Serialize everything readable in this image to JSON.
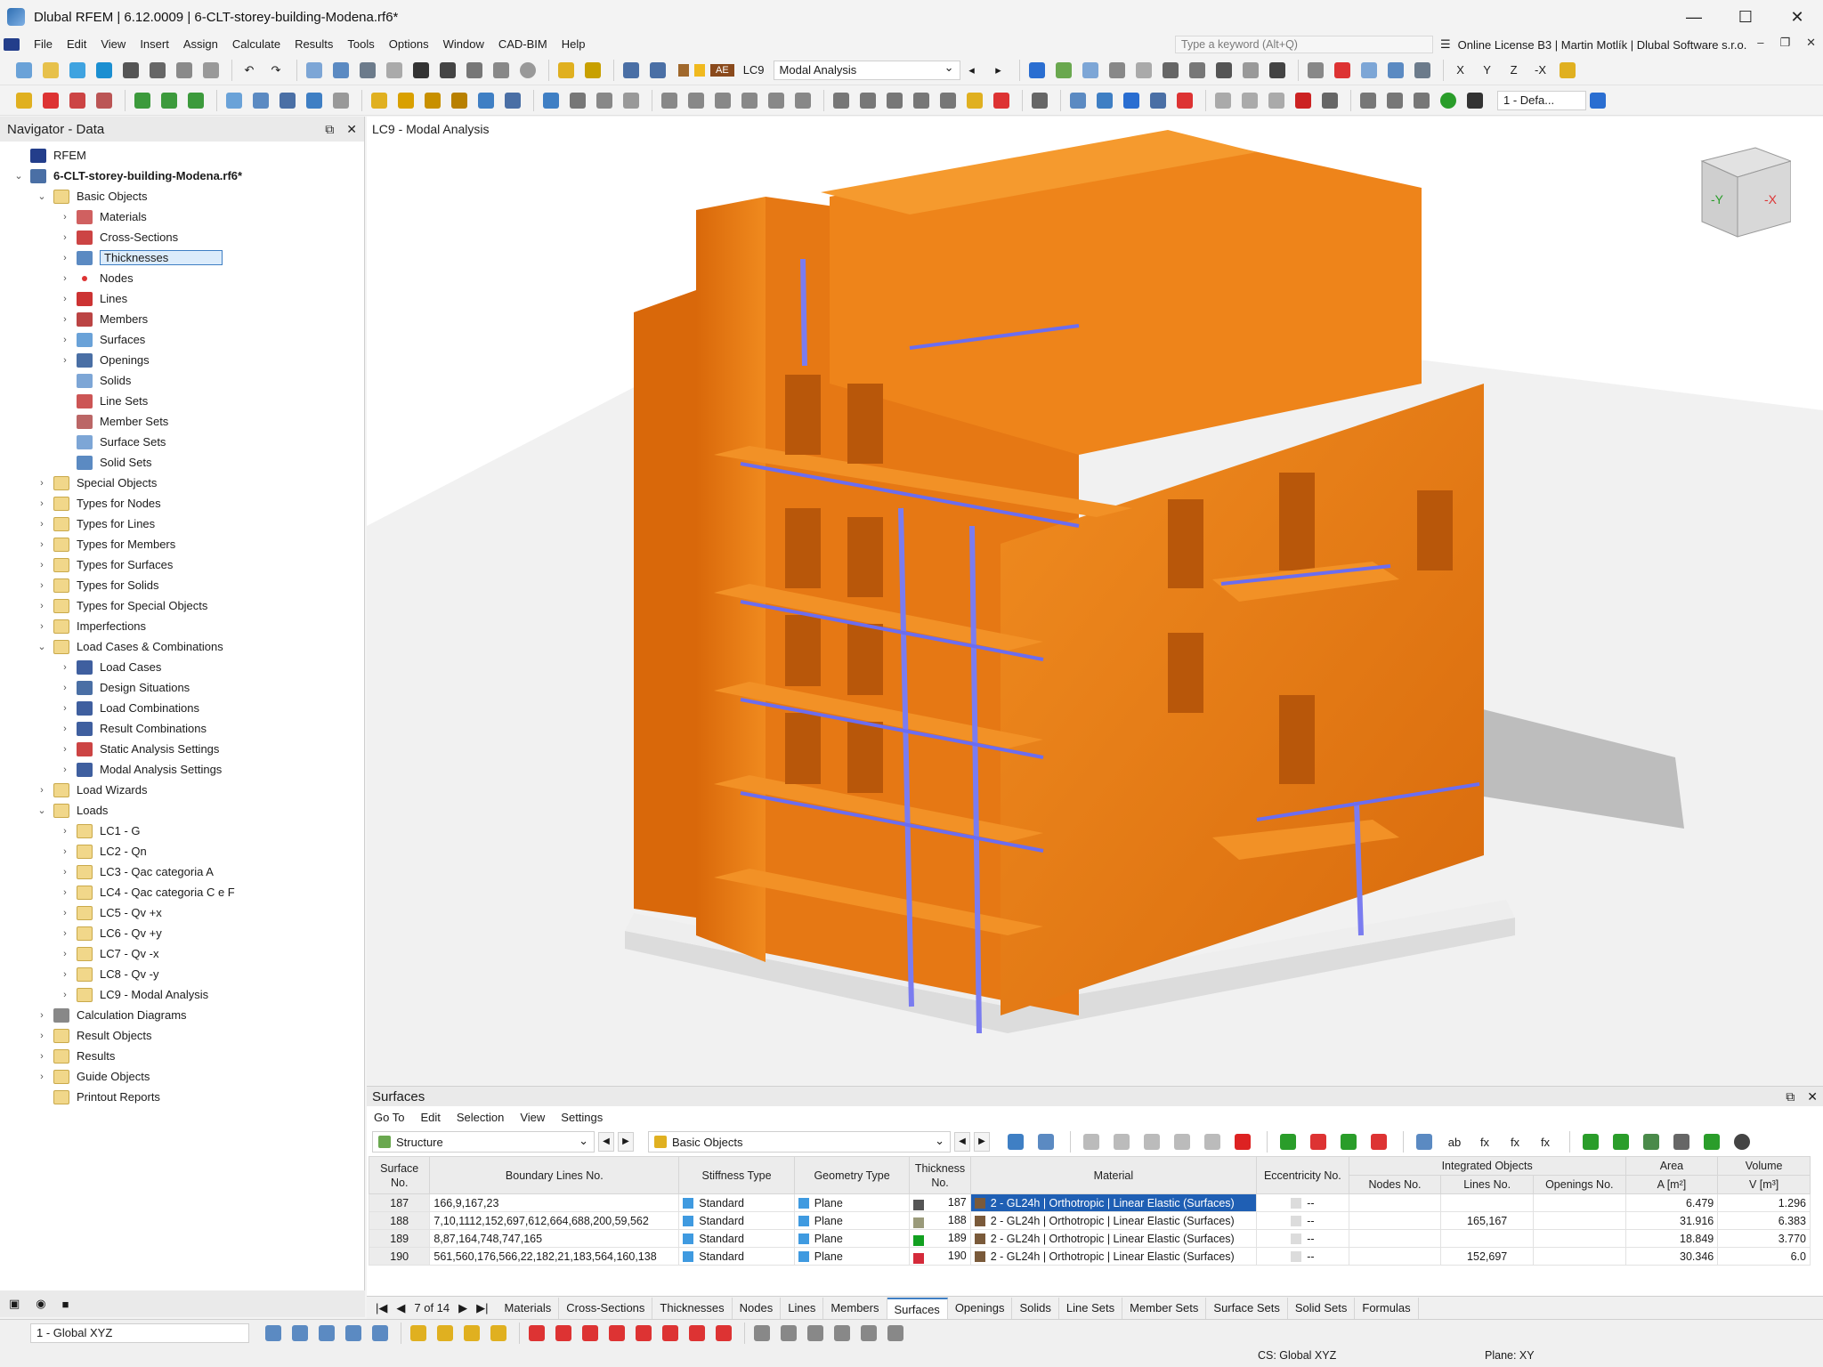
{
  "window": {
    "title": "Dlubal RFEM | 6.12.0009 | 6-CLT-storey-building-Modena.rf6*"
  },
  "menu": [
    "File",
    "Edit",
    "View",
    "Insert",
    "Assign",
    "Calculate",
    "Results",
    "Tools",
    "Options",
    "Window",
    "CAD-BIM",
    "Help"
  ],
  "search": {
    "placeholder": "Type a keyword (Alt+Q)"
  },
  "license": "Online License B3 | Martin Motlík | Dlubal Software s.r.o.",
  "toolbar": {
    "ae": "AE",
    "lc": "LC9",
    "lc_name": "Modal Analysis",
    "view_combo": "1 - Defa..."
  },
  "navigator": {
    "title": "Navigator - Data",
    "items": [
      {
        "label": "RFEM",
        "level": 0,
        "icon": "rfem-logo",
        "arrow": ""
      },
      {
        "label": "6-CLT-storey-building-Modena.rf6*",
        "level": 0,
        "icon": "file",
        "arrow": "v",
        "bold": true
      },
      {
        "label": "Basic Objects",
        "level": 1,
        "icon": "folder",
        "arrow": "v"
      },
      {
        "label": "Materials",
        "level": 2,
        "icon": "materials",
        "arrow": ">"
      },
      {
        "label": "Cross-Sections",
        "level": 2,
        "icon": "cross-sections",
        "arrow": ">"
      },
      {
        "label": "Thicknesses",
        "level": 2,
        "icon": "thicknesses",
        "arrow": ">",
        "selected": true
      },
      {
        "label": "Nodes",
        "level": 2,
        "icon": "nodes",
        "arrow": ">"
      },
      {
        "label": "Lines",
        "level": 2,
        "icon": "lines",
        "arrow": ">"
      },
      {
        "label": "Members",
        "level": 2,
        "icon": "members",
        "arrow": ">"
      },
      {
        "label": "Surfaces",
        "level": 2,
        "icon": "surfaces",
        "arrow": ">"
      },
      {
        "label": "Openings",
        "level": 2,
        "icon": "openings",
        "arrow": ">"
      },
      {
        "label": "Solids",
        "level": 2,
        "icon": "solids",
        "arrow": ""
      },
      {
        "label": "Line Sets",
        "level": 2,
        "icon": "line-sets",
        "arrow": ""
      },
      {
        "label": "Member Sets",
        "level": 2,
        "icon": "member-sets",
        "arrow": ""
      },
      {
        "label": "Surface Sets",
        "level": 2,
        "icon": "surface-sets",
        "arrow": ""
      },
      {
        "label": "Solid Sets",
        "level": 2,
        "icon": "solid-sets",
        "arrow": ""
      },
      {
        "label": "Special Objects",
        "level": 1,
        "icon": "folder",
        "arrow": ">"
      },
      {
        "label": "Types for Nodes",
        "level": 1,
        "icon": "folder",
        "arrow": ">"
      },
      {
        "label": "Types for Lines",
        "level": 1,
        "icon": "folder",
        "arrow": ">"
      },
      {
        "label": "Types for Members",
        "level": 1,
        "icon": "folder",
        "arrow": ">"
      },
      {
        "label": "Types for Surfaces",
        "level": 1,
        "icon": "folder",
        "arrow": ">"
      },
      {
        "label": "Types for Solids",
        "level": 1,
        "icon": "folder",
        "arrow": ">"
      },
      {
        "label": "Types for Special Objects",
        "level": 1,
        "icon": "folder",
        "arrow": ">"
      },
      {
        "label": "Imperfections",
        "level": 1,
        "icon": "folder",
        "arrow": ">"
      },
      {
        "label": "Load Cases & Combinations",
        "level": 1,
        "icon": "folder",
        "arrow": "v"
      },
      {
        "label": "Load Cases",
        "level": 2,
        "icon": "load-cases",
        "arrow": ">"
      },
      {
        "label": "Design Situations",
        "level": 2,
        "icon": "design-situations",
        "arrow": ">"
      },
      {
        "label": "Load Combinations",
        "level": 2,
        "icon": "load-combinations",
        "arrow": ">"
      },
      {
        "label": "Result Combinations",
        "level": 2,
        "icon": "result-combinations",
        "arrow": ">"
      },
      {
        "label": "Static Analysis Settings",
        "level": 2,
        "icon": "static-settings",
        "arrow": ">"
      },
      {
        "label": "Modal Analysis Settings",
        "level": 2,
        "icon": "modal-settings",
        "arrow": ">"
      },
      {
        "label": "Load Wizards",
        "level": 1,
        "icon": "folder",
        "arrow": ">"
      },
      {
        "label": "Loads",
        "level": 1,
        "icon": "folder",
        "arrow": "v"
      },
      {
        "label": "LC1 - G",
        "level": 2,
        "icon": "folder",
        "arrow": ">"
      },
      {
        "label": "LC2 - Qn",
        "level": 2,
        "icon": "folder",
        "arrow": ">"
      },
      {
        "label": "LC3 - Qac categoria A",
        "level": 2,
        "icon": "folder",
        "arrow": ">"
      },
      {
        "label": "LC4 - Qac categoria C e F",
        "level": 2,
        "icon": "folder",
        "arrow": ">"
      },
      {
        "label": "LC5 - Qv +x",
        "level": 2,
        "icon": "folder",
        "arrow": ">"
      },
      {
        "label": "LC6 - Qv +y",
        "level": 2,
        "icon": "folder",
        "arrow": ">"
      },
      {
        "label": "LC7 - Qv -x",
        "level": 2,
        "icon": "folder",
        "arrow": ">"
      },
      {
        "label": "LC8 - Qv -y",
        "level": 2,
        "icon": "folder",
        "arrow": ">"
      },
      {
        "label": "LC9 - Modal Analysis",
        "level": 2,
        "icon": "folder",
        "arrow": ">"
      },
      {
        "label": "Calculation Diagrams",
        "level": 1,
        "icon": "calc-diagrams",
        "arrow": ">"
      },
      {
        "label": "Result Objects",
        "level": 1,
        "icon": "folder",
        "arrow": ">"
      },
      {
        "label": "Results",
        "level": 1,
        "icon": "folder",
        "arrow": ">"
      },
      {
        "label": "Guide Objects",
        "level": 1,
        "icon": "folder",
        "arrow": ">"
      },
      {
        "label": "Printout Reports",
        "level": 1,
        "icon": "folder",
        "arrow": ""
      }
    ]
  },
  "viewport": {
    "title": "LC9 - Modal Analysis",
    "cube_y": "-Y",
    "cube_x": "-X"
  },
  "panel": {
    "title": "Surfaces",
    "menu": [
      "Go To",
      "Edit",
      "Selection",
      "View",
      "Settings"
    ],
    "combo1": "Structure",
    "combo2": "Basic Objects",
    "headers": {
      "surface_no": "Surface No.",
      "boundary": "Boundary Lines No.",
      "stiffness": "Stiffness Type",
      "geometry": "Geometry Type",
      "thickness": "Thickness No.",
      "material": "Material",
      "eccentricity": "Eccentricity No.",
      "integrated": "Integrated Objects",
      "nodes": "Nodes No.",
      "lines": "Lines No.",
      "openings": "Openings No.",
      "area": "Area",
      "area_unit": "A [m²]",
      "volume": "Volume",
      "volume_unit": "V [m³]"
    },
    "rows": [
      {
        "no": "187",
        "boundary": "166,9,167,23",
        "stiffness": "Standard",
        "geometry": "Plane",
        "thickness": "187",
        "tcolor": "#555555",
        "material": "2 - GL24h | Orthotropic | Linear Elastic (Surfaces)",
        "ecc": "--",
        "nodes": "",
        "lines": "",
        "openings": "",
        "area": "6.479",
        "volume": "1.296",
        "selected": true
      },
      {
        "no": "188",
        "boundary": "7,10,1112,152,697,612,664,688,200,59,562",
        "stiffness": "Standard",
        "geometry": "Plane",
        "thickness": "188",
        "tcolor": "#9a9a7a",
        "material": "2 - GL24h | Orthotropic | Linear Elastic (Surfaces)",
        "ecc": "--",
        "nodes": "",
        "lines": "165,167",
        "openings": "",
        "area": "31.916",
        "volume": "6.383"
      },
      {
        "no": "189",
        "boundary": "8,87,164,748,747,165",
        "stiffness": "Standard",
        "geometry": "Plane",
        "thickness": "189",
        "tcolor": "#12a020",
        "material": "2 - GL24h | Orthotropic | Linear Elastic (Surfaces)",
        "ecc": "--",
        "nodes": "",
        "lines": "",
        "openings": "",
        "area": "18.849",
        "volume": "3.770"
      },
      {
        "no": "190",
        "boundary": "561,560,176,566,22,182,21,183,564,160,138",
        "stiffness": "Standard",
        "geometry": "Plane",
        "thickness": "190",
        "tcolor": "#d42a3a",
        "material": "2 - GL24h | Orthotropic | Linear Elastic (Surfaces)",
        "ecc": "--",
        "nodes": "",
        "lines": "152,697",
        "openings": "",
        "area": "30.346",
        "volume": "6.0"
      }
    ]
  },
  "tabs": {
    "pager": "7 of 14",
    "items": [
      "Materials",
      "Cross-Sections",
      "Thicknesses",
      "Nodes",
      "Lines",
      "Members",
      "Surfaces",
      "Openings",
      "Solids",
      "Line Sets",
      "Member Sets",
      "Surface Sets",
      "Solid Sets",
      "Formulas"
    ],
    "active": "Surfaces"
  },
  "status": {
    "cs_select": "1 - Global XYZ",
    "cs": "CS: Global XYZ",
    "plane": "Plane: XY"
  },
  "colors": {
    "timber": "#e87a0f",
    "accent": "#3f7fc4",
    "selection": "#1f5fb4",
    "column_blue": "#7a7cf0"
  }
}
